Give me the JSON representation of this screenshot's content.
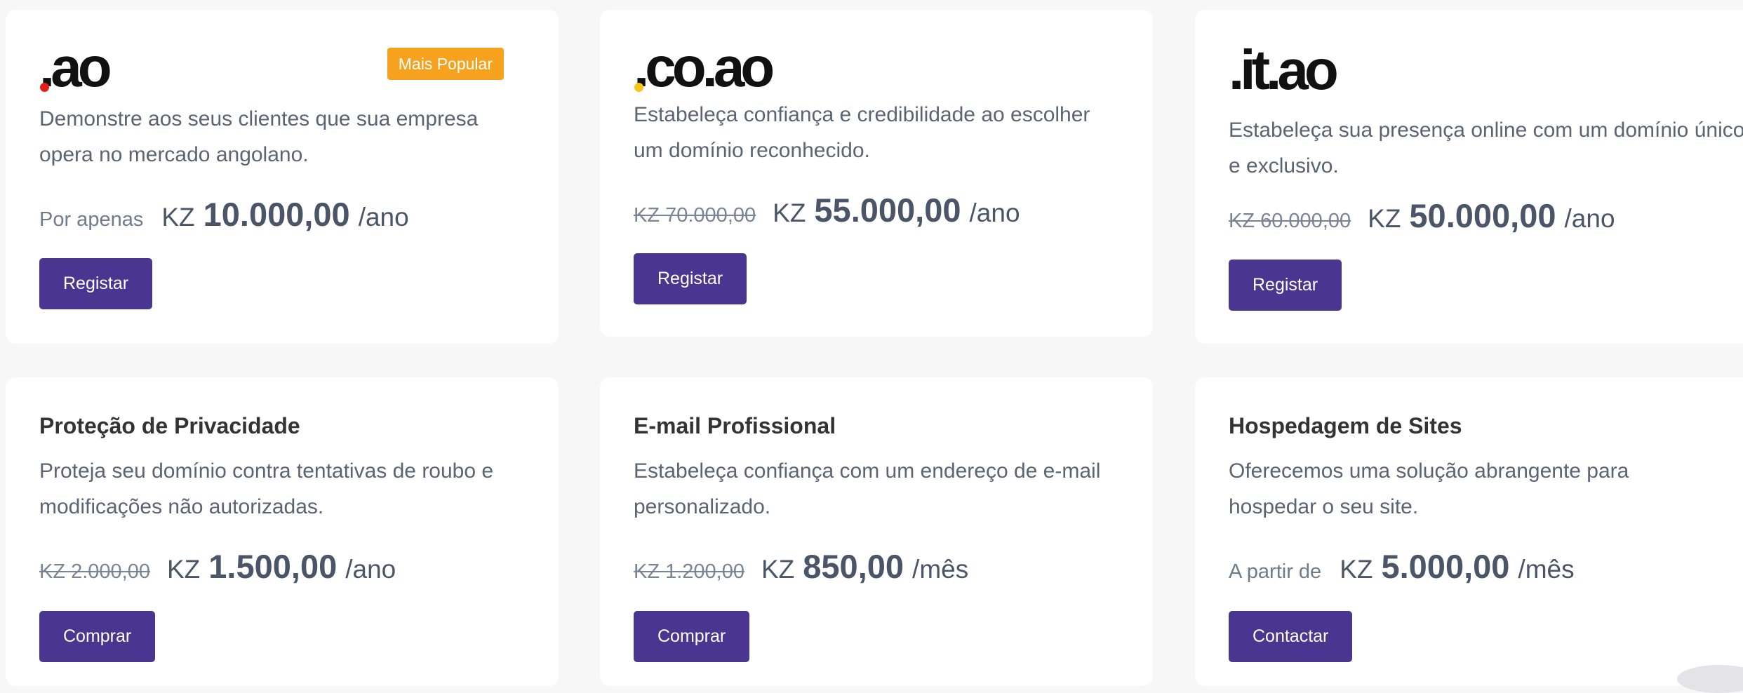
{
  "domains": [
    {
      "logo_text": ".ao",
      "dot_color": "#e0201b",
      "badge": "Mais Popular",
      "description": "Demonstre aos seus clientes que sua empresa opera no mercado angolano.",
      "price_prefix": "Por apenas",
      "currency": "KZ",
      "price": "10.000,00",
      "period": "/ano",
      "button": "Registar"
    },
    {
      "logo_text": ".co.ao",
      "dot_color": "#f5c518",
      "description": "Estabeleça confiança e credibilidade ao escolher um domínio reconhecido.",
      "old_price": "KZ 70.000,00",
      "currency": "KZ",
      "price": "55.000,00",
      "period": "/ano",
      "button": "Registar"
    },
    {
      "logo_text": ".it.ao",
      "dot_color": "#111111",
      "description": "Estabeleça sua presença online com um domínio único e exclusivo.",
      "old_price": "KZ 60.000,00",
      "currency": "KZ",
      "price": "50.000,00",
      "period": "/ano",
      "button": "Registar"
    }
  ],
  "services": [
    {
      "title": "Proteção de Privacidade",
      "description": "Proteja seu domínio contra tentativas de roubo e modificações não autorizadas.",
      "old_price": "KZ 2.000,00",
      "currency": "KZ",
      "price": "1.500,00",
      "period": "/ano",
      "button": "Comprar"
    },
    {
      "title": "E-mail Profissional",
      "description": "Estabeleça confiança com um endereço de e-mail personalizado.",
      "old_price": "KZ 1.200,00",
      "currency": "KZ",
      "price": "850,00",
      "period": "/mês",
      "button": "Comprar"
    },
    {
      "title": "Hospedagem de Sites",
      "description": "Oferecemos uma solução abrangente para hospedar o seu site.",
      "price_prefix": "A partir de",
      "currency": "KZ",
      "price": "5.000,00",
      "period": "/mês",
      "button": "Contactar"
    }
  ],
  "colors": {
    "button": "#4a3690",
    "badge": "#f6a21e",
    "background": "#f7f7f8",
    "card": "#ffffff"
  }
}
